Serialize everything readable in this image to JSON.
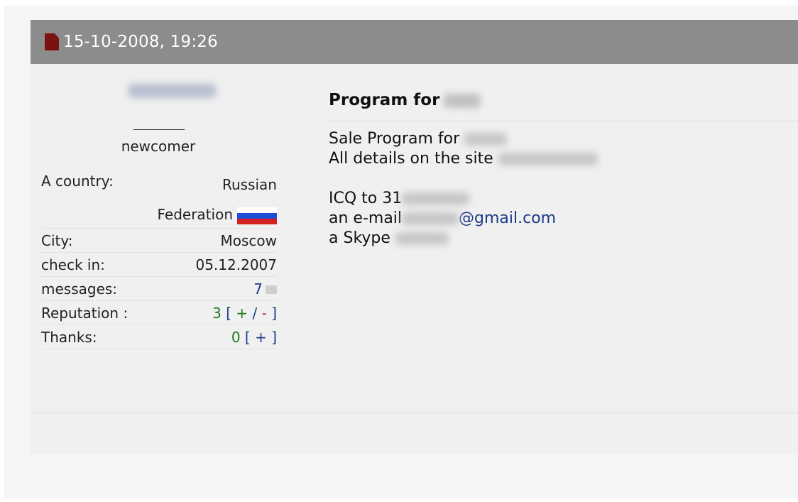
{
  "post": {
    "date": "15-10-2008, 19:26"
  },
  "user": {
    "rank": "newcomer",
    "country_label": "A country:",
    "country_value_line1": "Russian",
    "country_value_line2": "Federation",
    "city_label": "City:",
    "city_value": "Moscow",
    "checkin_label": "check in:",
    "checkin_value": "05.12.2007",
    "messages_label": "messages:",
    "messages_value": "7",
    "reputation_label": "Reputation :",
    "reputation_value": "3",
    "reputation_open": "[",
    "reputation_plus": "+",
    "reputation_sep": "/",
    "reputation_minus": "-",
    "reputation_close": "]",
    "thanks_label": "Thanks:",
    "thanks_value": "0",
    "thanks_action": "[ + ]"
  },
  "content": {
    "title_prefix": "Program for",
    "line1": "Sale Program for",
    "line2": "All details on the site",
    "line3": "ICQ to 31",
    "line4_prefix": "an e-mail",
    "line4_domain": "@gmail.com",
    "line5": "a Skype"
  },
  "icons": {
    "post": "document-icon",
    "flag": "russia-flag-icon",
    "messages": "messages-icon"
  },
  "colors": {
    "header_bg": "#8c8c8c",
    "link_blue": "#1e3a8a",
    "positive_green": "#1e7a1e",
    "negative_red": "#c01818"
  }
}
